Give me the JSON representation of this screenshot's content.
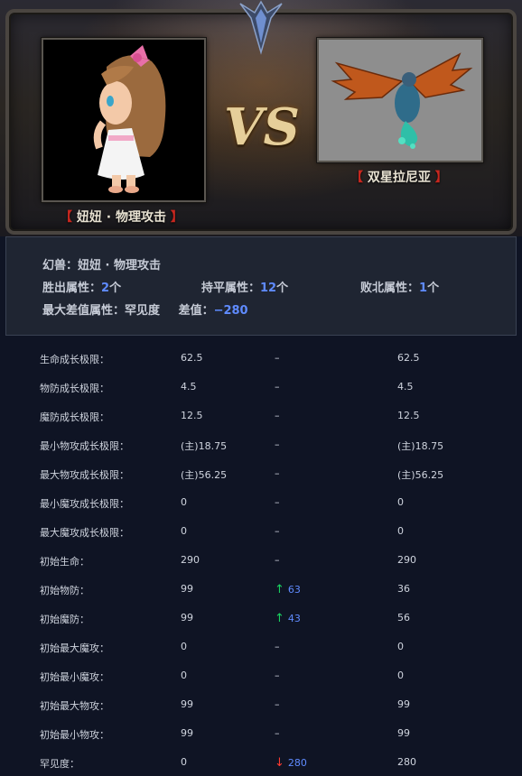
{
  "left": {
    "name": "妞妞 · 物理攻击"
  },
  "right": {
    "name": "双星拉尼亚"
  },
  "vs_text": "VS",
  "summary": {
    "pet_label": "幻兽：",
    "pet_name": "妞妞 · 物理攻击",
    "win_label": "胜出属性：",
    "win_count": "2",
    "tie_label": "持平属性：",
    "tie_count": "12",
    "lose_label": "败北属性：",
    "lose_count": "1",
    "unit": "个",
    "maxdiff_label": "最大差值属性：",
    "maxdiff_attr": "罕见度",
    "diff_label": "差值：",
    "diff_value": "−280"
  },
  "rows": [
    {
      "label": "生命成长极限：",
      "left": "62.5",
      "diff": "–",
      "right": "62.5"
    },
    {
      "label": "物防成长极限：",
      "left": "4.5",
      "diff": "–",
      "right": "4.5"
    },
    {
      "label": "魔防成长极限：",
      "left": "12.5",
      "diff": "–",
      "right": "12.5"
    },
    {
      "label": "最小物攻成长极限：",
      "left": "(主)18.75",
      "diff": "–",
      "right": "(主)18.75"
    },
    {
      "label": "最大物攻成长极限：",
      "left": "(主)56.25",
      "diff": "–",
      "right": "(主)56.25"
    },
    {
      "label": "最小魔攻成长极限：",
      "left": "0",
      "diff": "–",
      "right": "0"
    },
    {
      "label": "最大魔攻成长极限：",
      "left": "0",
      "diff": "–",
      "right": "0"
    },
    {
      "label": "初始生命：",
      "left": "290",
      "diff": "–",
      "right": "290"
    },
    {
      "label": "初始物防：",
      "left": "99",
      "diff_arrow": "↑",
      "diff_dir": "up",
      "diff_num": "63",
      "right": "36"
    },
    {
      "label": "初始魔防：",
      "left": "99",
      "diff_arrow": "↑",
      "diff_dir": "up",
      "diff_num": "43",
      "right": "56"
    },
    {
      "label": "初始最大魔攻：",
      "left": "0",
      "diff": "–",
      "right": "0"
    },
    {
      "label": "初始最小魔攻：",
      "left": "0",
      "diff": "–",
      "right": "0"
    },
    {
      "label": "初始最大物攻：",
      "left": "99",
      "diff": "–",
      "right": "99"
    },
    {
      "label": "初始最小物攻：",
      "left": "99",
      "diff": "–",
      "right": "99"
    },
    {
      "label": "罕见度：",
      "left": "0",
      "diff_arrow": "↓",
      "diff_dir": "down",
      "diff_num": "280",
      "right": "280"
    }
  ]
}
